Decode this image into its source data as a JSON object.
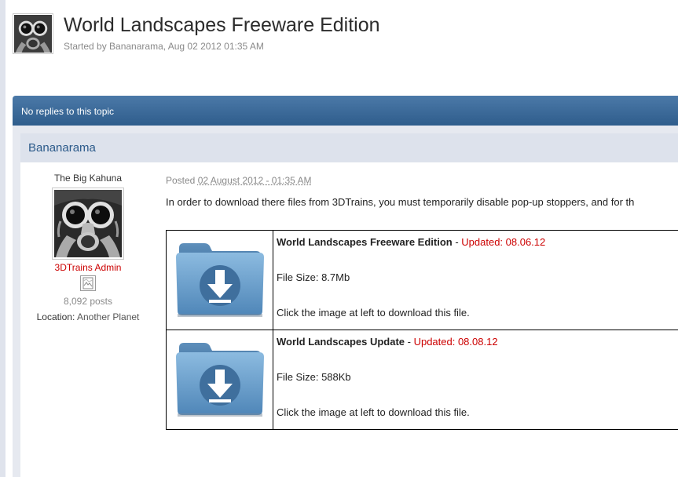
{
  "topic": {
    "title": "World Landscapes Freeware Edition",
    "meta": "Started by Bananarama, Aug 02 2012 01:35 AM"
  },
  "replies_bar": {
    "label": "No replies to this topic"
  },
  "post": {
    "author": {
      "name": "Bananarama",
      "member_title": "The Big Kahuna",
      "group": "3DTrains Admin",
      "post_count": "8,092 posts",
      "location_label": "Location:",
      "location_value": "Another Planet"
    },
    "posted_prefix": "Posted",
    "posted_date": "02 August 2012 - 01:35 AM",
    "intro": "In order to download there files from 3DTrains, you must temporarily disable pop-up stoppers, and for th",
    "downloads": [
      {
        "name": "World Landscapes Freeware Edition",
        "separator": " - ",
        "updated": "Updated: 08.06.12",
        "size": "File Size: 8.7Mb",
        "hint": "Click the image at left to download this file."
      },
      {
        "name": "World Landscapes Update",
        "separator": " - ",
        "updated": "Updated: 08.08.12",
        "size": "File Size: 588Kb",
        "hint": "Click the image at left to download this file."
      }
    ]
  },
  "icons": {
    "starter_avatar": "gas-mask-avatar-icon",
    "author_avatar": "gas-mask-avatar-icon",
    "group_icon": "broken-image-icon",
    "download": "download-folder-icon"
  },
  "colors": {
    "accent_blue": "#2f5d8c",
    "group_red": "#cc0000",
    "updated_red": "#cc0000",
    "folder_blue": "#6d9fc8"
  }
}
